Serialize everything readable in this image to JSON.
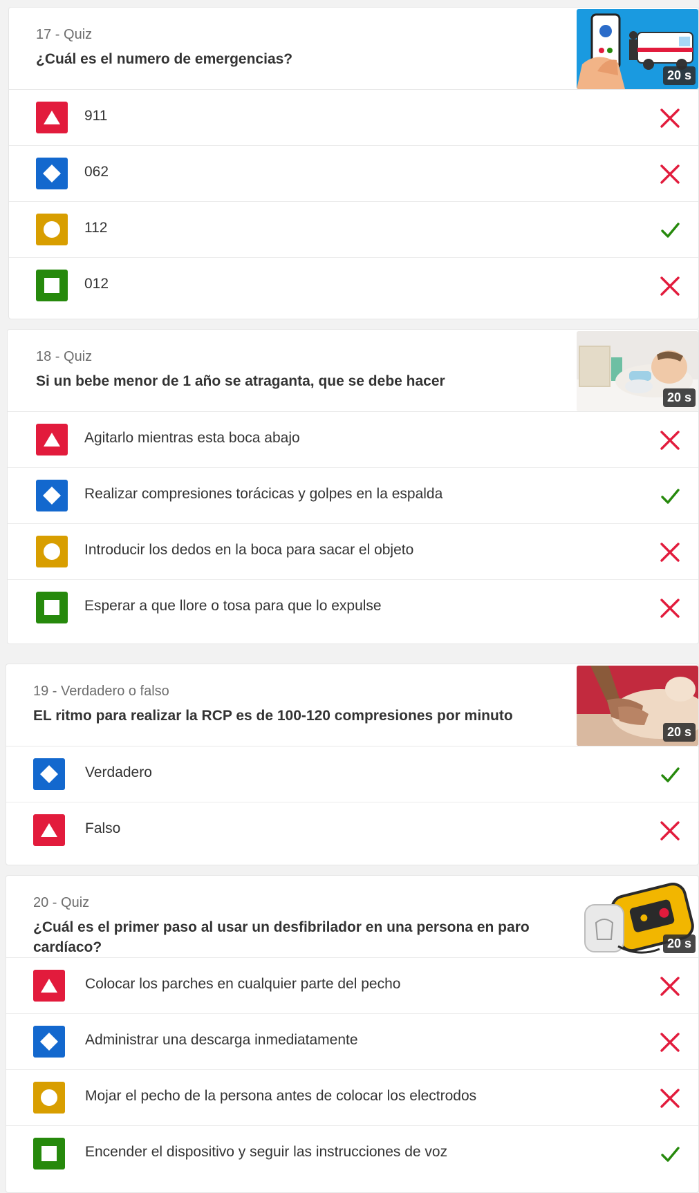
{
  "questions": [
    {
      "meta": "17 - Quiz",
      "text": "¿Cuál es el numero de emergencias?",
      "time": "20 s",
      "thumbnail": "phone-ambulance-illustration",
      "answers": [
        {
          "shape": "triangle",
          "color": "red",
          "text": "911",
          "result": "incorrect"
        },
        {
          "shape": "diamond",
          "color": "blue",
          "text": "062",
          "result": "incorrect"
        },
        {
          "shape": "circle",
          "color": "yellow",
          "text": "112",
          "result": "correct"
        },
        {
          "shape": "square",
          "color": "green",
          "text": "012",
          "result": "incorrect"
        }
      ]
    },
    {
      "meta": "18 - Quiz",
      "text": "Si un bebe menor de 1 año se atraganta, que se debe hacer",
      "time": "20 s",
      "thumbnail": "baby-photo",
      "answers": [
        {
          "shape": "triangle",
          "color": "red",
          "text": "Agitarlo mientras esta boca abajo",
          "result": "incorrect"
        },
        {
          "shape": "diamond",
          "color": "blue",
          "text": "Realizar compresiones torácicas y golpes en la espalda",
          "result": "correct"
        },
        {
          "shape": "circle",
          "color": "yellow",
          "text": "Introducir los dedos en la boca para sacar el objeto",
          "result": "incorrect"
        },
        {
          "shape": "square",
          "color": "green",
          "text": "Esperar a que llore o tosa para que lo expulse",
          "result": "incorrect"
        }
      ]
    },
    {
      "meta": "19 - Verdadero o falso",
      "text": "EL ritmo para realizar la RCP es de 100-120 compresiones por minuto",
      "time": "20 s",
      "thumbnail": "cpr-mannequin-photo",
      "answers": [
        {
          "shape": "diamond",
          "color": "blue",
          "text": "Verdadero",
          "result": "correct"
        },
        {
          "shape": "triangle",
          "color": "red",
          "text": "Falso",
          "result": "incorrect"
        }
      ]
    },
    {
      "meta": "20 - Quiz",
      "text": "¿Cuál es el primer paso al usar un desfibrilador en una persona en paro cardíaco?",
      "time": "20 s",
      "thumbnail": "defibrillator-photo",
      "answers": [
        {
          "shape": "triangle",
          "color": "red",
          "text": "Colocar los parches en cualquier parte del pecho",
          "result": "incorrect"
        },
        {
          "shape": "diamond",
          "color": "blue",
          "text": "Administrar una descarga inmediatamente",
          "result": "incorrect"
        },
        {
          "shape": "circle",
          "color": "yellow",
          "text": "Mojar el pecho de la persona antes de colocar los electrodos",
          "result": "incorrect"
        },
        {
          "shape": "square",
          "color": "green",
          "text": "Encender el dispositivo y seguir las instrucciones de voz",
          "result": "correct"
        }
      ]
    }
  ],
  "colors": {
    "red": "#e21b3c",
    "blue": "#1368ce",
    "yellow": "#d89e00",
    "green": "#26890c",
    "incorrect_icon": "#e21b3c",
    "correct_icon": "#26890c"
  }
}
